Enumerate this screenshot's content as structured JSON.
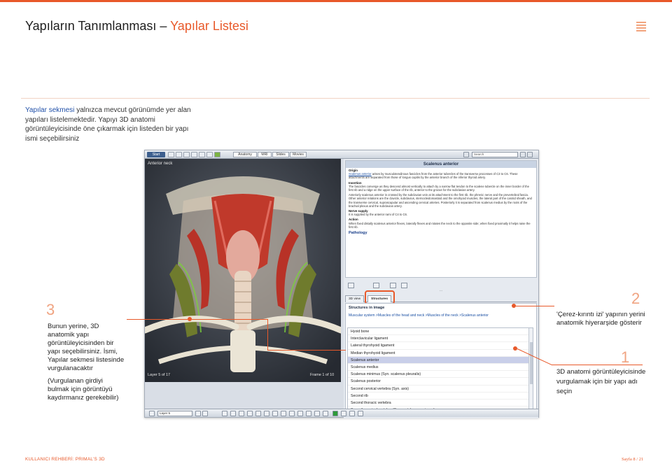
{
  "header": {
    "title_main": "Yapıların Tanımlanması –",
    "title_accent": "Yapılar Listesi"
  },
  "intro": {
    "highlight": "Yapılar sekmesi",
    "text": "yalnızca mevcut görünümde yer alan yapıları listelemektedir. Yapıyı 3D anatomi görüntüleyicisinde öne çıkarmak için listeden bir yapı ismi seçebilirsiniz"
  },
  "steps": {
    "step3": {
      "number": "3",
      "text": "Bunun yerine, 3D anatomik yapı görüntüleyicisinden bir yapı seçebilirsiniz. İsmi, Yapılar sekmesi listesinde vurgulanacaktır",
      "note": "(Vurgulanan girdiyi bulmak için görüntüyü kaydırmanız gerekebilir)"
    },
    "step2": {
      "number": "2",
      "text": "'Çerez-kırıntı izi' yapının yerini anatomik hiyerarşide gösterir"
    },
    "step1": {
      "number": "1",
      "text": "3D anatomi görüntüleyicisinde vurgulamak için bir yapı adı seçin"
    }
  },
  "app": {
    "toolbar": {
      "start": "Start",
      "tabs": [
        "Anatomy",
        "MRI",
        "Slides",
        "Movies"
      ],
      "search_placeholder": "Search"
    },
    "viewer": {
      "label": "Anterior neck",
      "layer": "Layer 5 of 17",
      "frame": "Frame 1 of 10"
    },
    "info": {
      "title": "Scalenus anterior",
      "origin_head": "Origin",
      "origin_link": "Scalenus anterior",
      "origin_text": "arises by musculotendinous fascicles from the anterior tubercles of the transverse processes of C3 to C6. These attachments are separated from those of longus capitis by the anterior branch of the inferior thyroid artery.",
      "insertion_head": "Insertion",
      "insertion_text": "The fascicles converge as they descend almost vertically to attach by a narrow flat tendon to the scalene tubercle on the inner border of the first rib and a ridge on the upper surface of the rib, anterior to the groove for the subclavian artery.",
      "relations_text": "Anteriorly scalenus anterior is crossed by the subclavian vein at its attachment to the first rib, the phrenic nerve and the prevertebral fascia. Other anterior relations are the clavicle, subclavius, sternocleidomastoid and the omohyoid muscles, the lateral part of the carotid sheath, and the transverse cervical, suprascapular and ascending cervical arteries. Posteriorly it is separated from scalenus medius by the roots of the brachial plexus and the subclavian artery.",
      "nerve_head": "Nerve supply",
      "nerve_text": "It is supplied by the anterior rami of C4 to C6.",
      "action_head": "Action",
      "action_text": "When fixed distally scalenus anterior flexes, laterally flexes and rotates the neck to the opposite side; when fixed proximally it helps raise the first rib.",
      "pathology": "Pathology"
    },
    "tabs": {
      "tab1": "3D view",
      "tab2": "Structures"
    },
    "structures": {
      "title": "Structures in image",
      "breadcrumb": "Muscular system >Muscles of the head and neck >Muscles of the neck >Scalenus anterior",
      "items": [
        "Hyoid bone",
        "Interclavicular ligament",
        "Lateral thyrohyoid ligament",
        "Median thyrohyoid ligament",
        "Scalenus anterior",
        "Scalenus medius",
        "Scalenus minimus (Syn. scalenus pleuralis)",
        "Scalenus posterior",
        "Second cervical vertebra (Syn. axis)",
        "Second rib",
        "Second thoracic vertebra",
        "Seventh cervical vertebra (Syn. vertebra prominens)"
      ],
      "selected_index": 4
    },
    "bottom": {
      "layer_select": "Layer 5"
    }
  },
  "footer": {
    "left": "KULLANICI REHBERİ: PRIMAL'S 3D",
    "right": "Sayfa 8 / 21"
  },
  "colors": {
    "accent": "#e8592a",
    "link": "#1f4fa8",
    "selection": "#c9cfe9"
  }
}
